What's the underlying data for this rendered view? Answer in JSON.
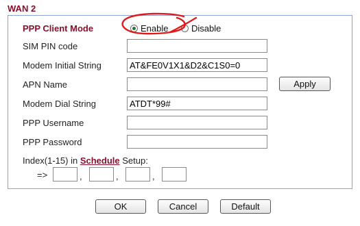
{
  "section_title": "WAN 2",
  "ppp_mode": {
    "label": "PPP Client Mode",
    "options": [
      "Enable",
      "Disable"
    ],
    "selected": "Enable"
  },
  "fields": {
    "sim_pin": {
      "label": "SIM PIN code",
      "value": ""
    },
    "modem_init": {
      "label": "Modem Initial String",
      "value": "AT&FE0V1X1&D2&C1S0=0"
    },
    "apn": {
      "label": "APN Name",
      "value": ""
    },
    "dial": {
      "label": "Modem Dial String",
      "value": "ATDT*99#"
    },
    "ppp_user": {
      "label": "PPP Username",
      "value": ""
    },
    "ppp_pass": {
      "label": "PPP Password",
      "value": ""
    }
  },
  "apply_label": "Apply",
  "schedule": {
    "prefix": "Index(1-15) in",
    "link": "Schedule",
    "suffix": "Setup:",
    "arrow": "=>",
    "separator": ",",
    "values": [
      "",
      "",
      "",
      ""
    ]
  },
  "buttons": {
    "ok": "OK",
    "cancel": "Cancel",
    "default": "Default"
  },
  "colors": {
    "accent": "#8b0e2a",
    "annotation": "#e01a1a",
    "panel_border": "#8ba3cf"
  }
}
